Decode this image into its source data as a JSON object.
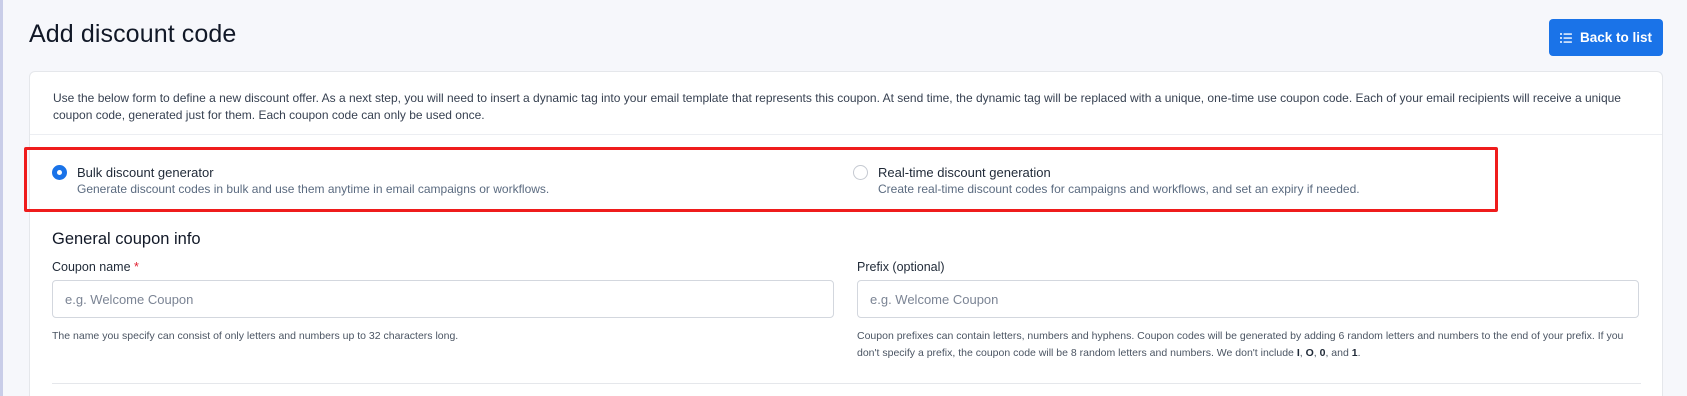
{
  "header": {
    "title": "Add discount code",
    "back_button_label": "Back to list",
    "back_button_icon": "list-icon"
  },
  "intro": {
    "text": "Use the below form to define a new discount offer. As a next step, you will need to insert a dynamic tag into your email template that represents this coupon. At send time, the dynamic tag will be replaced with a unique, one-time use coupon code. Each of your email recipients will receive a unique coupon code, generated just for them. Each coupon code can only be used once."
  },
  "generation_mode": {
    "options": [
      {
        "title": "Bulk discount generator",
        "description": "Generate discount codes in bulk and use them anytime in email campaigns or workflows.",
        "selected": true
      },
      {
        "title": "Real-time discount generation",
        "description": "Create real-time discount codes for campaigns and workflows, and set an expiry if needed.",
        "selected": false
      }
    ]
  },
  "general_info": {
    "section_title": "General coupon info",
    "coupon_name": {
      "label": "Coupon name",
      "required_marker": "*",
      "value": "",
      "placeholder": "e.g. Welcome Coupon",
      "help": "The name you specify can consist of only letters and numbers up to 32 characters long."
    },
    "prefix": {
      "label": "Prefix (optional)",
      "value": "",
      "placeholder": "e.g. Welcome Coupon",
      "help_part1": "Coupon prefixes can contain letters, numbers and hyphens. Coupon codes will be generated by adding 6 random letters and numbers to the end of your prefix. If you don't specify a prefix, the coupon code will be 8 random letters and numbers. We don't include ",
      "help_excluded_1": "I",
      "help_sep_1": ", ",
      "help_excluded_2": "O",
      "help_sep_2": ", ",
      "help_excluded_3": "0",
      "help_sep_3": ", and ",
      "help_excluded_4": "1",
      "help_end": "."
    }
  },
  "colors": {
    "accent": "#1a73e8",
    "highlight": "#ef1c1c",
    "required": "#e11d2e"
  }
}
